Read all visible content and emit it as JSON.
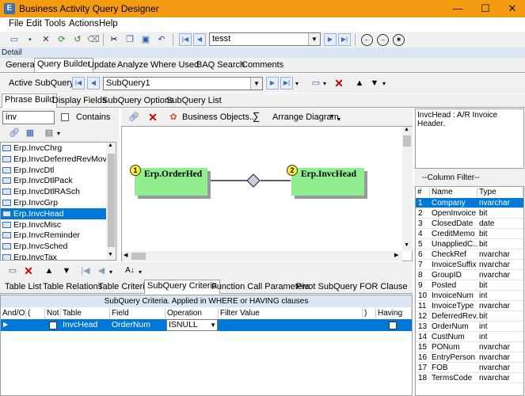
{
  "window": {
    "title": "Business Activity Query Designer",
    "minimize": "—",
    "maximize": "☐",
    "close": "✕"
  },
  "menu": [
    "File",
    "Edit",
    "Tools",
    "Actions",
    "Help"
  ],
  "toolbar": {
    "record_value": "tesst"
  },
  "detail_label": "Detail",
  "main_tabs": [
    "General",
    "Query Builder",
    "Update",
    "Analyze",
    "Where Used",
    "BAQ Search",
    "Comments"
  ],
  "active_subquery": {
    "label": "Active SubQuery:",
    "value": "SubQuery1"
  },
  "sub_tabs": [
    "Phrase Build",
    "Display Fields",
    "SubQuery Options",
    "SubQuery List"
  ],
  "search": {
    "value": "inv",
    "contains_label": "Contains"
  },
  "tables": [
    "Erp.InvcChrg",
    "Erp.InvcDeferredRevMov",
    "Erp.InvcDtl",
    "Erp.InvcDtlPack",
    "Erp.InvcDtlRASch",
    "Erp.InvcGrp",
    "Erp.InvcHead",
    "Erp.InvcMisc",
    "Erp.InvcReminder",
    "Erp.InvcSched",
    "Erp.InvcTax"
  ],
  "selected_table": "Erp.InvcHead",
  "diagram_toolbar": {
    "business_objects": "Business Objects...",
    "sigma": "∑",
    "arrange": "Arrange Diagram"
  },
  "nodes": [
    {
      "num": "1",
      "name": "Erp.OrderHed"
    },
    {
      "num": "2",
      "name": "Erp.InvcHead"
    }
  ],
  "table_desc": "InvcHead : A/R Invoice Header.",
  "column_filter": "--Column Filter--",
  "columns_header": {
    "num": "#",
    "name": "Name",
    "type": "Type"
  },
  "columns": [
    {
      "n": "1",
      "name": "Company",
      "type": "nvarchar"
    },
    {
      "n": "2",
      "name": "OpenInvoice",
      "type": "bit"
    },
    {
      "n": "3",
      "name": "ClosedDate",
      "type": "date"
    },
    {
      "n": "4",
      "name": "CreditMemo",
      "type": "bit"
    },
    {
      "n": "5",
      "name": "UnappliedC...",
      "type": "bit"
    },
    {
      "n": "6",
      "name": "CheckRef",
      "type": "nvarchar"
    },
    {
      "n": "7",
      "name": "InvoiceSuffix",
      "type": "nvarchar"
    },
    {
      "n": "8",
      "name": "GroupID",
      "type": "nvarchar"
    },
    {
      "n": "9",
      "name": "Posted",
      "type": "bit"
    },
    {
      "n": "10",
      "name": "InvoiceNum",
      "type": "int"
    },
    {
      "n": "11",
      "name": "InvoiceType",
      "type": "nvarchar"
    },
    {
      "n": "12",
      "name": "DeferredRev...",
      "type": "bit"
    },
    {
      "n": "13",
      "name": "OrderNum",
      "type": "int"
    },
    {
      "n": "14",
      "name": "CustNum",
      "type": "int"
    },
    {
      "n": "15",
      "name": "PONum",
      "type": "nvarchar"
    },
    {
      "n": "16",
      "name": "EntryPerson",
      "type": "nvarchar"
    },
    {
      "n": "17",
      "name": "FOB",
      "type": "nvarchar"
    },
    {
      "n": "18",
      "name": "TermsCode",
      "type": "nvarchar"
    }
  ],
  "bottom_tabs": [
    "Table List",
    "Table Relations",
    "Table Criteria",
    "SubQuery Criteria",
    "Function Call Parameters",
    "Pivot SubQuery FOR Clause"
  ],
  "criteria": {
    "caption": "SubQuery Criteria. Applied in WHERE or HAVING clauses",
    "headers": {
      "andor": "And/O",
      "paren": "(",
      "not": "Not",
      "table": "Table",
      "field": "Field",
      "operation": "Operation",
      "filter": "Filter Value",
      "rparen": ")",
      "having": "Having"
    },
    "row": {
      "table": "InvcHead",
      "field": "OrderNum",
      "operation": "ISNULL"
    }
  }
}
